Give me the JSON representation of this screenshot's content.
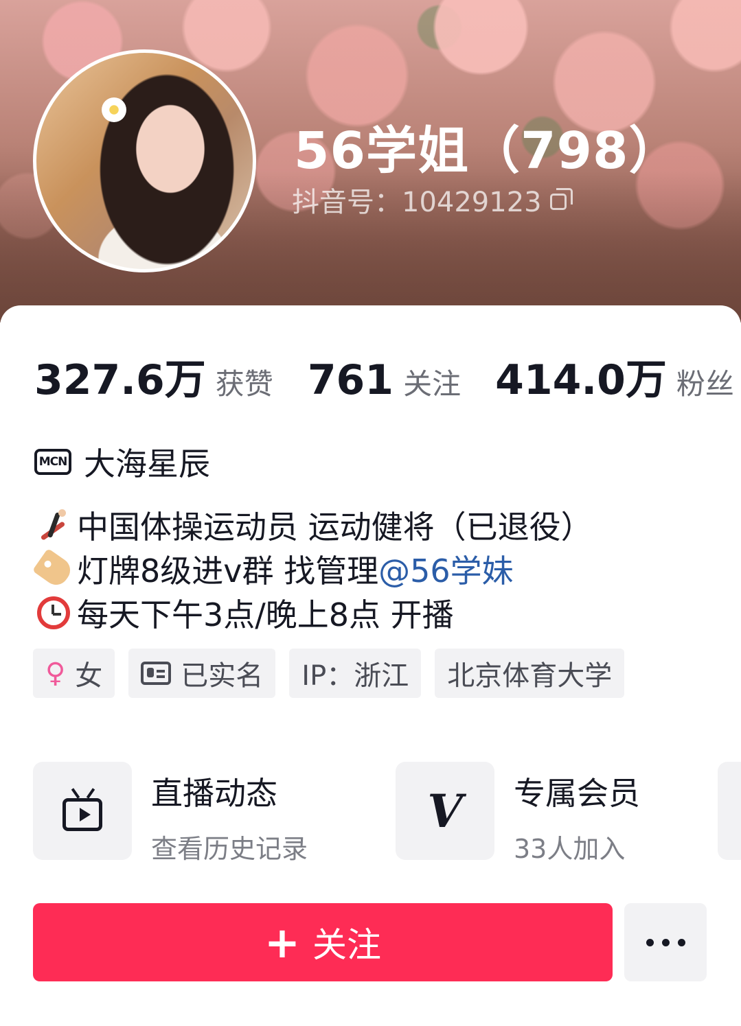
{
  "profile": {
    "nickname": "56学姐（798）",
    "douyin_id": "抖音号：10429123"
  },
  "stats": [
    {
      "value": "327.6万",
      "label": "获赞"
    },
    {
      "value": "761",
      "label": "关注"
    },
    {
      "value": "414.0万",
      "label": "粉丝"
    }
  ],
  "mcn": {
    "icon_text": "MCN",
    "name": "大海星辰"
  },
  "bio": {
    "line1": "中国体操运动员 运动健将（已退役）",
    "line2_prefix": "灯牌8级进v群 找管理",
    "line2_mention": "@56学妹",
    "line3": "每天下午3点/晚上8点 开播"
  },
  "tags": {
    "gender": "女",
    "verified": "已实名",
    "ip": "IP：浙江",
    "school": "北京体育大学"
  },
  "features": [
    {
      "title": "直播动态",
      "subtitle": "查看历史记录",
      "icon": "tv-play-icon"
    },
    {
      "title": "专属会员",
      "subtitle": "33人加入",
      "icon": "vip-v-icon"
    }
  ],
  "actions": {
    "follow_plus": "+",
    "follow_label": "关注"
  },
  "colors": {
    "accent": "#fe2c55",
    "mention": "#2b5da8",
    "text": "#161823"
  }
}
